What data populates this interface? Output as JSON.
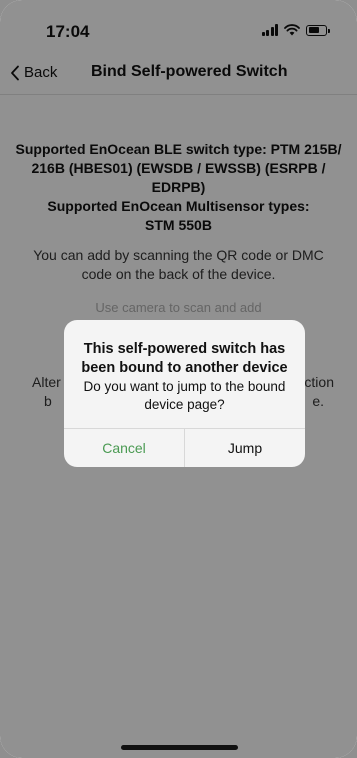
{
  "status_bar": {
    "time": "17:04",
    "icons": [
      "cellular-signal-icon",
      "wifi-icon",
      "battery-icon"
    ]
  },
  "nav": {
    "back_label": "Back",
    "title": "Bind Self-powered Switch"
  },
  "content": {
    "supported_line1": "Supported EnOcean BLE switch type: PTM 215B/",
    "supported_line2": "216B (HBES01) (EWSDB / EWSSB) (ESRPB /",
    "supported_line3": "EDRPB)",
    "supported_line4": "Supported EnOcean Multisensor types:",
    "supported_line5": "STM 550B",
    "instructions": "You can add by scanning the QR code or DMC code on the back of the device.",
    "camera_link": "Use camera to scan and add",
    "alt_left": "Alter",
    "alt_left2": "b",
    "alt_right": "ction",
    "alt_right2": "e."
  },
  "dialog": {
    "title": "This self-powered switch has been bound to another device",
    "message": "Do you want to jump to the bound device page?",
    "cancel_label": "Cancel",
    "jump_label": "Jump"
  },
  "colors": {
    "accent_green": "#4a9a52",
    "overlay": "rgba(0,0,0,0.40)"
  }
}
